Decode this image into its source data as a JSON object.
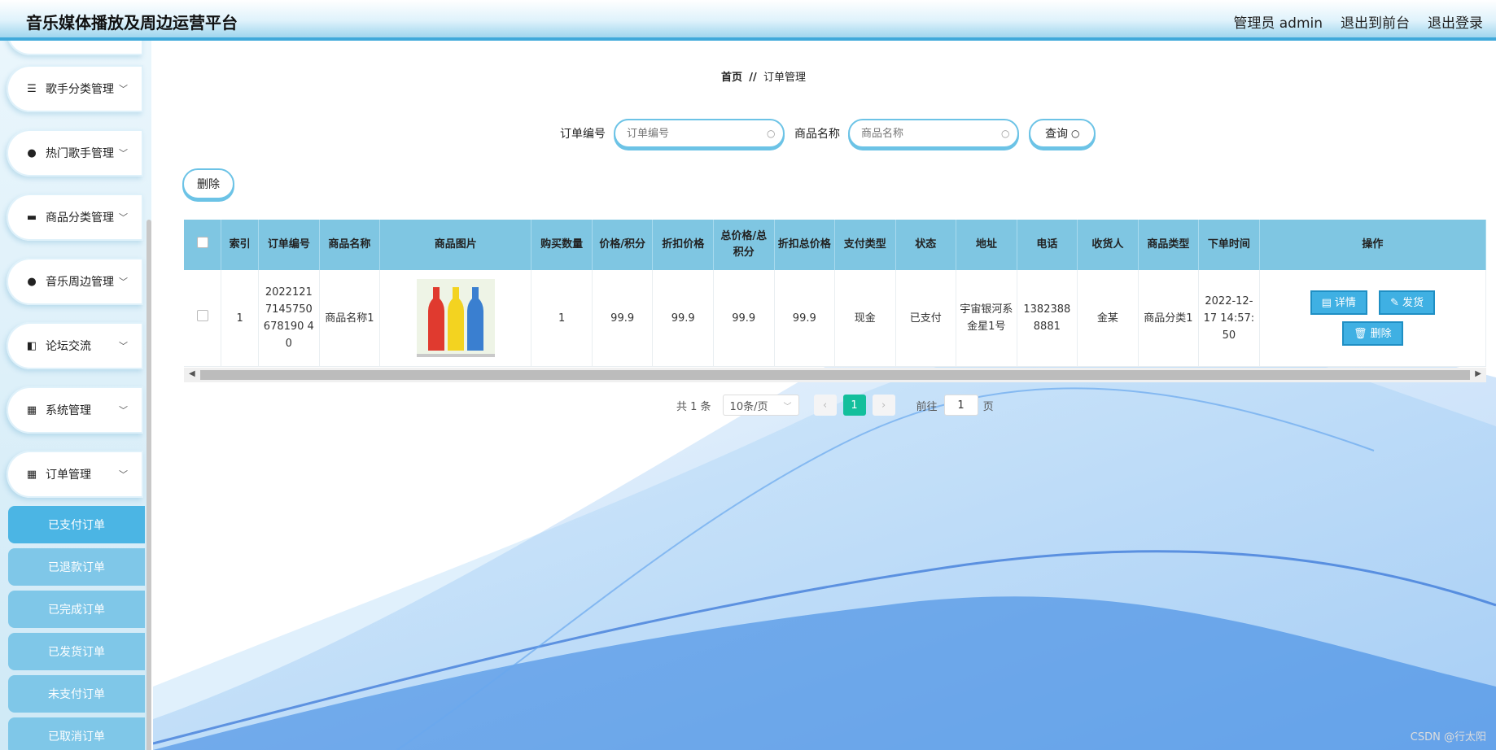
{
  "header": {
    "title": "音乐媒体播放及周边运营平台",
    "user": "管理员 admin",
    "to_front": "退出到前台",
    "logout": "退出登录"
  },
  "sidebar": {
    "menus": [
      {
        "label": "歌手分类管理",
        "icon": "list-icon"
      },
      {
        "label": "热门歌手管理",
        "icon": "person-icon"
      },
      {
        "label": "商品分类管理",
        "icon": "box-icon"
      },
      {
        "label": "音乐周边管理",
        "icon": "person-icon"
      },
      {
        "label": "论坛交流",
        "icon": "chat-icon"
      },
      {
        "label": "系统管理",
        "icon": "grid-icon"
      },
      {
        "label": "订单管理",
        "icon": "grid-icon"
      }
    ],
    "sub_items": [
      "已支付订单",
      "已退款订单",
      "已完成订单",
      "已发货订单",
      "未支付订单",
      "已取消订单"
    ]
  },
  "breadcrumb": {
    "home": "首页",
    "sep": "//",
    "current": "订单管理"
  },
  "search": {
    "order_label": "订单编号",
    "order_placeholder": "订单编号",
    "product_label": "商品名称",
    "product_placeholder": "商品名称",
    "query_label": "查询"
  },
  "toolbar": {
    "delete_label": "删除"
  },
  "table": {
    "headers": [
      "索引",
      "订单编号",
      "商品名称",
      "商品图片",
      "购买数量",
      "价格/积分",
      "折扣价格",
      "总价格/总积分",
      "折扣总价格",
      "支付类型",
      "状态",
      "地址",
      "电话",
      "收货人",
      "商品类型",
      "下单时间",
      "操作"
    ],
    "rows": [
      {
        "index": "1",
        "order_no": "20221217145750678190 40",
        "product_name": "商品名称1",
        "quantity": "1",
        "price": "99.9",
        "discount_price": "99.9",
        "total": "99.9",
        "discount_total": "99.9",
        "pay_type": "现金",
        "status": "已支付",
        "address": "宇宙银河系金星1号",
        "phone": "13823888881",
        "receiver": "金某",
        "product_type": "商品分类1",
        "order_time": "2022-12-17 14:57:50",
        "actions": {
          "detail": "详情",
          "ship": "发货",
          "delete": "删除"
        }
      }
    ]
  },
  "pagination": {
    "total": "共 1 条",
    "page_size": "10条/页",
    "current": "1",
    "goto_prefix": "前往",
    "goto_value": "1",
    "goto_suffix": "页"
  },
  "watermark": "CSDN @行太阳",
  "colors": {
    "accent": "#3fb0e3",
    "header_border": "#3fa9da",
    "pager_active": "#13bf9c"
  }
}
